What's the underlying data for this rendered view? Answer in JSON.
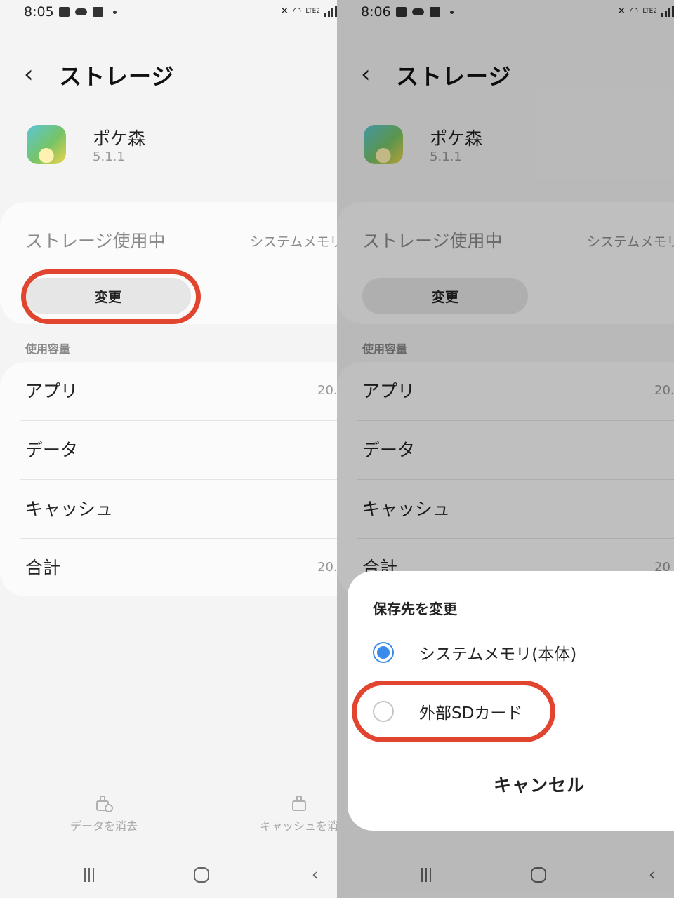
{
  "screens": [
    {
      "status": {
        "time": "8:05"
      },
      "header": {
        "title": "ストレージ"
      },
      "app": {
        "name": "ポケ森",
        "version": "5.1.1"
      },
      "storage": {
        "label": "ストレージ使用中",
        "value": "システムメモリ",
        "change_label": "変更"
      },
      "usage_section_label": "使用容量",
      "usage": [
        {
          "label": "アプリ",
          "value": "20."
        },
        {
          "label": "データ",
          "value": ""
        },
        {
          "label": "キャッシュ",
          "value": ""
        },
        {
          "label": "合計",
          "value": "20."
        }
      ],
      "bottom_actions": {
        "clear_data": "データを消去",
        "clear_cache": "キャッシュを消"
      }
    },
    {
      "status": {
        "time": "8:06"
      },
      "header": {
        "title": "ストレージ"
      },
      "app": {
        "name": "ポケ森",
        "version": "5.1.1"
      },
      "storage": {
        "label": "ストレージ使用中",
        "value": "システムメモリ",
        "change_label": "変更"
      },
      "usage_section_label": "使用容量",
      "usage": [
        {
          "label": "アプリ",
          "value": "20."
        },
        {
          "label": "データ",
          "value": ""
        },
        {
          "label": "キャッシュ",
          "value": ""
        },
        {
          "label": "合計",
          "value": "20"
        }
      ],
      "dialog": {
        "title": "保存先を変更",
        "options": [
          {
            "label": "システムメモリ(本体)",
            "selected": true
          },
          {
            "label": "外部SDカード",
            "selected": false
          }
        ],
        "cancel_label": "キャンセル"
      }
    }
  ],
  "status_indicator": "LTE2",
  "colors": {
    "accent": "#3a8bea",
    "highlight": "#e2452f",
    "background": "#f4f4f4"
  }
}
